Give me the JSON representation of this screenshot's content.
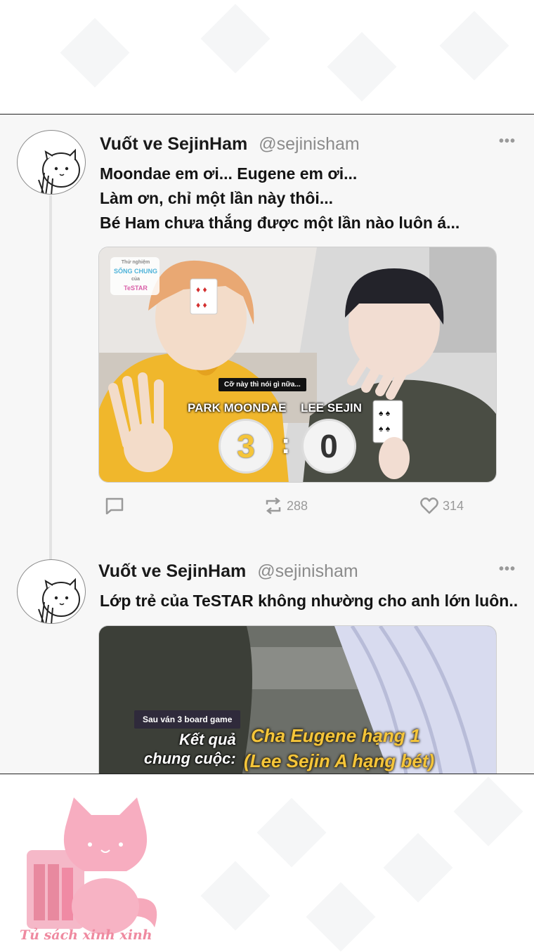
{
  "tweets": [
    {
      "display_name": "Vuốt ve SejinHam",
      "handle": "@sejinisham",
      "lines": [
        "Moondae em ơi... Eugene em ơi...",
        "Làm ơn, chỉ một lần này thôi...",
        "Bé Ham chưa thắng được một lần nào luôn á..."
      ],
      "media": {
        "logo": [
          "Thử nghiệm",
          "SỐNG CHUNG",
          "của",
          "TeSTAR"
        ],
        "caption": "Cỡ này thì nói gì nữa...",
        "left_name": "PARK MOONDAE",
        "right_name": "LEE SEJIN",
        "left_score": "3",
        "separator": ":",
        "right_score": "0"
      },
      "actions": {
        "retweets": "288",
        "likes": "314"
      }
    },
    {
      "display_name": "Vuốt ve SejinHam",
      "handle": "@sejinisham",
      "lines": [
        "Lớp trẻ của TeSTAR không nhường cho anh lớn luôn.."
      ],
      "media": {
        "caption": "Sau ván 3 board game",
        "result_label_1": "Kết quả",
        "result_label_2": "chung cuộc:",
        "result_1": "Cha Eugene hạng 1",
        "result_2": "(Lee Sejin A hạng bét)"
      }
    }
  ],
  "watermark": "Tủ sách xinh xinh",
  "icons": [
    "more-icon",
    "reply-icon",
    "retweet-icon",
    "like-icon",
    "hamster-avatar-icon",
    "cat-logo-icon"
  ],
  "colors": {
    "panel": "#f7f7f7",
    "name": "#1a1a1a",
    "handle": "#8b8b8b",
    "score_yellow": "#f5c53a",
    "watermark": "#ef8aa0"
  }
}
